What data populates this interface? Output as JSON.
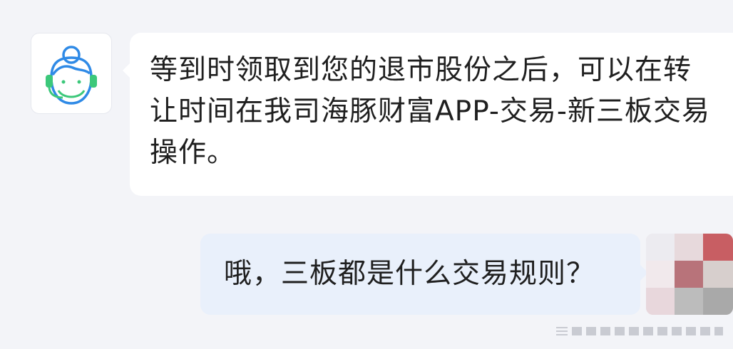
{
  "messages": [
    {
      "role": "agent",
      "avatar_icon": "customer-service-agent-icon",
      "text": "等到时领取到您的退市股份之后，可以在转让时间在我司海豚财富APP-交易-新三板交易操作。"
    },
    {
      "role": "user",
      "avatar_icon": "user-avatar-pixelated",
      "text": "哦，三板都是什么交易规则？"
    }
  ],
  "colors": {
    "background": "#f3f4f8",
    "agent_bubble": "#ffffff",
    "user_bubble": "#e9f0fb",
    "text": "#1f1f1f",
    "avatar_accent_blue": "#2f8ae6",
    "avatar_accent_green": "#3cc87a"
  }
}
